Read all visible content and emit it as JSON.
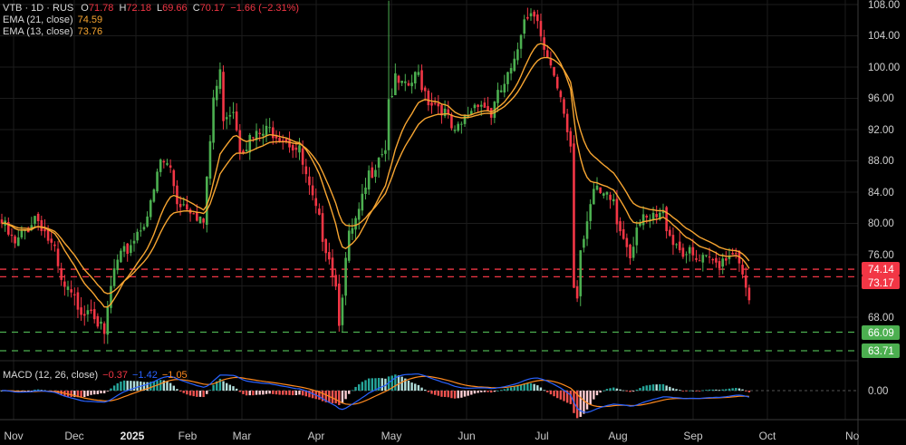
{
  "chart_data": {
    "type": "candlestick",
    "symbol": "VTB",
    "interval": "1D",
    "exchange": "RUS",
    "header": {
      "title": "VTB · 1D · RUS",
      "o_label": "O",
      "o": "71.78",
      "h_label": "H",
      "h": "72.18",
      "l_label": "L",
      "l": "69.66",
      "c_label": "C",
      "c": "70.17",
      "change": "−1.66 (−2.31%)"
    },
    "indicators": {
      "ema21": {
        "label": "EMA (21, close)",
        "value": "74.59",
        "period": 21
      },
      "ema13": {
        "label": "EMA (13, close)",
        "value": "73.76",
        "period": 13
      },
      "macd": {
        "label": "MACD (12, 26, close)",
        "hist": "−0.37",
        "macd": "−1.42",
        "signal": "−1.05",
        "fast": 12,
        "slow": 26,
        "signal_period": 9,
        "zero_label": "0.00"
      }
    },
    "ylim": [
      66,
      108
    ],
    "y_ticks": [
      "108.00",
      "104.00",
      "100.00",
      "96.00",
      "92.00",
      "88.00",
      "84.00",
      "80.00",
      "76.00",
      "68.00"
    ],
    "y_tick_values": [
      108,
      104,
      100,
      96,
      92,
      88,
      84,
      80,
      76,
      68
    ],
    "x_ticks": [
      "Nov",
      "Dec",
      "2025",
      "Feb",
      "Mar",
      "Apr",
      "May",
      "Jun",
      "Jul",
      "Aug",
      "Sep",
      "Oct",
      "No"
    ],
    "levels": [
      {
        "value": 74.14,
        "label": "74.14",
        "kind": "resistance"
      },
      {
        "value": 73.17,
        "label": "73.17",
        "kind": "resistance"
      },
      {
        "value": 66.09,
        "label": "66.09",
        "kind": "support"
      },
      {
        "value": 63.71,
        "label": "63.71",
        "kind": "support"
      }
    ],
    "close_anchors_by_bar": [
      [
        0,
        80
      ],
      [
        4,
        77
      ],
      [
        10,
        81
      ],
      [
        12,
        80
      ],
      [
        16,
        76
      ],
      [
        18,
        72
      ],
      [
        22,
        70
      ],
      [
        25,
        69
      ],
      [
        27,
        70
      ],
      [
        31,
        65
      ],
      [
        32,
        69
      ],
      [
        34,
        74
      ],
      [
        37,
        76
      ],
      [
        41,
        79
      ],
      [
        45,
        82
      ],
      [
        48,
        88
      ],
      [
        51,
        87
      ],
      [
        53,
        83
      ],
      [
        58,
        82
      ],
      [
        61,
        80
      ],
      [
        62,
        85
      ],
      [
        64,
        96
      ],
      [
        66,
        99
      ],
      [
        67,
        94
      ],
      [
        70,
        95
      ],
      [
        72,
        90
      ],
      [
        77,
        91
      ],
      [
        82,
        92
      ],
      [
        86,
        91
      ],
      [
        90,
        89
      ],
      [
        93,
        84
      ],
      [
        96,
        80
      ],
      [
        99,
        76
      ],
      [
        101,
        72
      ],
      [
        102,
        68
      ],
      [
        104,
        75
      ],
      [
        105,
        78
      ],
      [
        108,
        81
      ],
      [
        111,
        86
      ],
      [
        114,
        89
      ],
      [
        116,
        90
      ],
      [
        117,
        96
      ],
      [
        119,
        98
      ],
      [
        122,
        97
      ],
      [
        126,
        99
      ],
      [
        129,
        96
      ],
      [
        133,
        95
      ],
      [
        137,
        91
      ],
      [
        141,
        94
      ],
      [
        144,
        96
      ],
      [
        148,
        94
      ],
      [
        151,
        97
      ],
      [
        155,
        100
      ],
      [
        158,
        107
      ],
      [
        162,
        107
      ],
      [
        164,
        102
      ],
      [
        167,
        98
      ],
      [
        170,
        94
      ],
      [
        172,
        90
      ],
      [
        173,
        72
      ],
      [
        174,
        71
      ],
      [
        175,
        77
      ],
      [
        177,
        81
      ],
      [
        179,
        84
      ],
      [
        182,
        83
      ],
      [
        185,
        83
      ],
      [
        186,
        80
      ],
      [
        189,
        78
      ],
      [
        190,
        76
      ],
      [
        192,
        80
      ],
      [
        195,
        80
      ],
      [
        200,
        81
      ],
      [
        203,
        78
      ],
      [
        205,
        77
      ],
      [
        210,
        75
      ],
      [
        214,
        75
      ],
      [
        216,
        75
      ],
      [
        219,
        76
      ],
      [
        222,
        77
      ],
      [
        223,
        74
      ],
      [
        225,
        71.78
      ],
      [
        226,
        70.17
      ]
    ],
    "last_bar": {
      "open": 71.78,
      "high": 72.18,
      "low": 69.66,
      "close": 70.17
    },
    "colors": {
      "up": "#4caf50",
      "down": "#f23645",
      "ema": "#f7a531",
      "macd": "#2962ff",
      "signal": "#ff8a1f",
      "hist_up": "#26a69a",
      "hist_down": "#ef5350",
      "grid": "#1c1c1c"
    }
  }
}
